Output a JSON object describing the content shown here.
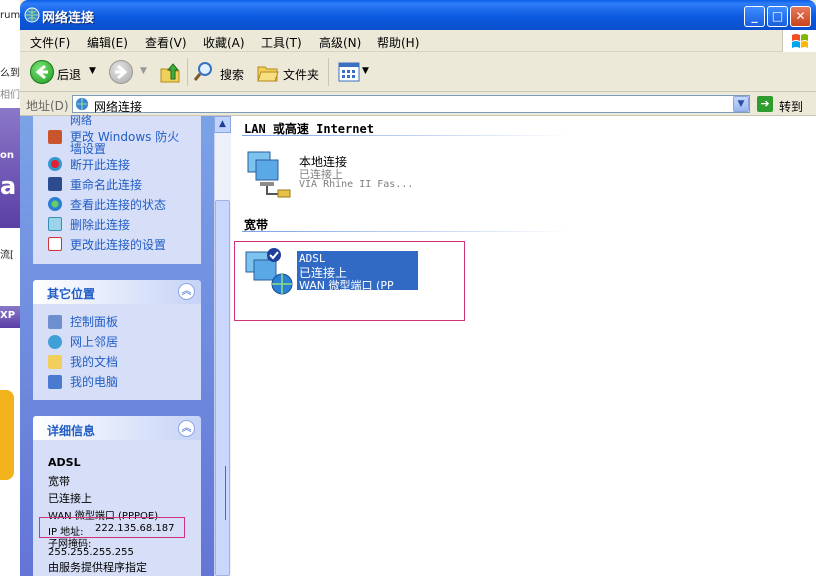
{
  "window": {
    "title": "网络连接",
    "controls": {
      "minimize": "_",
      "maximize": "□",
      "close": "✕"
    }
  },
  "menu": [
    {
      "label": "文件(F)"
    },
    {
      "label": "编辑(E)"
    },
    {
      "label": "查看(V)"
    },
    {
      "label": "收藏(A)"
    },
    {
      "label": "工具(T)"
    },
    {
      "label": "高级(N)"
    },
    {
      "label": "帮助(H)"
    }
  ],
  "toolbar": {
    "back_label": "后退",
    "search_label": "搜索",
    "folders_label": "文件夹"
  },
  "addressbar": {
    "label": "地址(D)",
    "value": "网络连接",
    "go_label": "转到"
  },
  "background": {
    "snippets": [
      "rum",
      "么到",
      "相们",
      "on",
      "a",
      "流[",
      "XP"
    ]
  },
  "taskpane": {
    "network_tasks": [
      {
        "label": "网络"
      },
      {
        "label_line1": "更改 Windows 防火",
        "label_line2": "墙设置"
      },
      {
        "label": "断开此连接"
      },
      {
        "label": "重命名此连接"
      },
      {
        "label": "查看此连接的状态"
      },
      {
        "label": "删除此连接"
      },
      {
        "label": "更改此连接的设置"
      }
    ],
    "other_places": {
      "title": "其它位置",
      "items": [
        "控制面板",
        "网上邻居",
        "我的文档",
        "我的电脑"
      ]
    },
    "details": {
      "title": "详细信息",
      "name": "ADSL",
      "type": "宽带",
      "status": "已连接上",
      "device": "WAN 微型端口 (PPPOE)",
      "ip_label": "IP 地址:",
      "ip": "222.135.68.187",
      "subnet_label": "子网掩码:",
      "subnet": "255.255.255.255",
      "assigned": "由服务提供程序指定"
    }
  },
  "content": {
    "groups": [
      {
        "title": "LAN 或高速 Internet",
        "items": [
          {
            "name": "本地连接",
            "status": "已连接上",
            "device": "VIA Rhine II Fas..."
          }
        ]
      },
      {
        "title": "宽带",
        "items": [
          {
            "name": "ADSL",
            "status": "已连接上",
            "device": "WAN 微型端口 (PP"
          }
        ]
      }
    ]
  },
  "colors": {
    "titlebar": "#0a5ee8",
    "taskpane_bg": "#7ba2e7",
    "panel_body": "#d6dff7",
    "link": "#215dc6",
    "selection": "#316ac5",
    "highlight_box": "#d0337a"
  },
  "icons": {
    "back": "back-arrow-icon",
    "forward": "forward-arrow-icon",
    "up": "folder-up-icon",
    "search": "search-icon",
    "folders": "folders-icon",
    "views": "views-icon"
  }
}
